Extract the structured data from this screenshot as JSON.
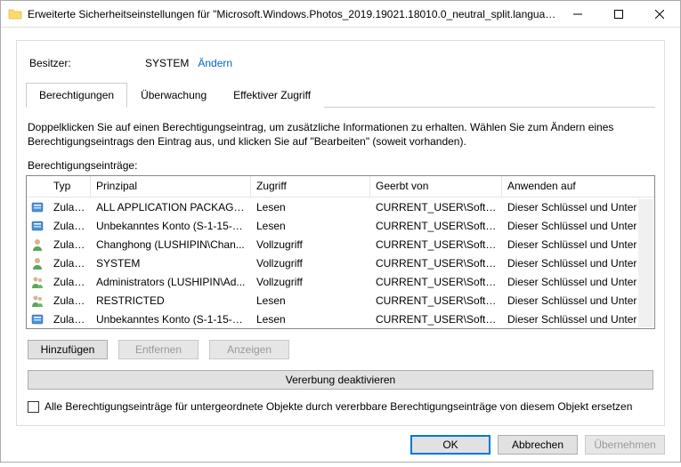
{
  "window": {
    "title": "Erweiterte Sicherheitseinstellungen für \"Microsoft.Windows.Photos_2019.19021.18010.0_neutral_split.language-..."
  },
  "owner": {
    "label": "Besitzer:",
    "value": "SYSTEM",
    "change_link": "Ändern"
  },
  "tabs": {
    "permissions": "Berechtigungen",
    "auditing": "Überwachung",
    "effective": "Effektiver Zugriff"
  },
  "instructions": "Doppelklicken Sie auf einen Berechtigungseintrag, um zusätzliche Informationen zu erhalten. Wählen Sie zum Ändern eines Berechtigungseintrags den Eintrag aus, und klicken Sie auf \"Bearbeiten\" (soweit vorhanden).",
  "entries_label": "Berechtigungseinträge:",
  "columns": {
    "type": "Typ",
    "principal": "Prinzipal",
    "access": "Zugriff",
    "inherited": "Geerbt von",
    "applies": "Anwenden auf"
  },
  "rows": [
    {
      "icon": "group-blue",
      "type": "Zulas...",
      "principal": "ALL APPLICATION PACKAGES",
      "access": "Lesen",
      "inherited": "CURRENT_USER\\Softw...",
      "applies": "Dieser Schlüssel und Unterschl..."
    },
    {
      "icon": "group-blue",
      "type": "Zulas...",
      "principal": "Unbekanntes Konto (S-1-15-3...",
      "access": "Lesen",
      "inherited": "CURRENT_USER\\Softw...",
      "applies": "Dieser Schlüssel und Unterschl..."
    },
    {
      "icon": "user",
      "type": "Zulas...",
      "principal": "Changhong (LUSHIPIN\\Chan...",
      "access": "Vollzugriff",
      "inherited": "CURRENT_USER\\Softw...",
      "applies": "Dieser Schlüssel und Unterschl..."
    },
    {
      "icon": "user",
      "type": "Zulas...",
      "principal": "SYSTEM",
      "access": "Vollzugriff",
      "inherited": "CURRENT_USER\\Softw...",
      "applies": "Dieser Schlüssel und Unterschl..."
    },
    {
      "icon": "users",
      "type": "Zulas...",
      "principal": "Administrators (LUSHIPIN\\Ad...",
      "access": "Vollzugriff",
      "inherited": "CURRENT_USER\\Softw...",
      "applies": "Dieser Schlüssel und Unterschl..."
    },
    {
      "icon": "users",
      "type": "Zulas...",
      "principal": "RESTRICTED",
      "access": "Lesen",
      "inherited": "CURRENT_USER\\Softw...",
      "applies": "Dieser Schlüssel und Unterschl..."
    },
    {
      "icon": "group-blue",
      "type": "Zulas...",
      "principal": "Unbekanntes Konto (S-1-15-3...",
      "access": "Lesen",
      "inherited": "CURRENT_USER\\Softw...",
      "applies": "Dieser Schlüssel und Unterschl..."
    }
  ],
  "buttons": {
    "add": "Hinzufügen",
    "remove": "Entfernen",
    "view": "Anzeigen",
    "disable_inherit": "Vererbung deaktivieren",
    "ok": "OK",
    "cancel": "Abbrechen",
    "apply": "Übernehmen"
  },
  "replace_checkbox": "Alle Berechtigungseinträge für untergeordnete Objekte durch vererbbare Berechtigungseinträge von diesem Objekt ersetzen"
}
